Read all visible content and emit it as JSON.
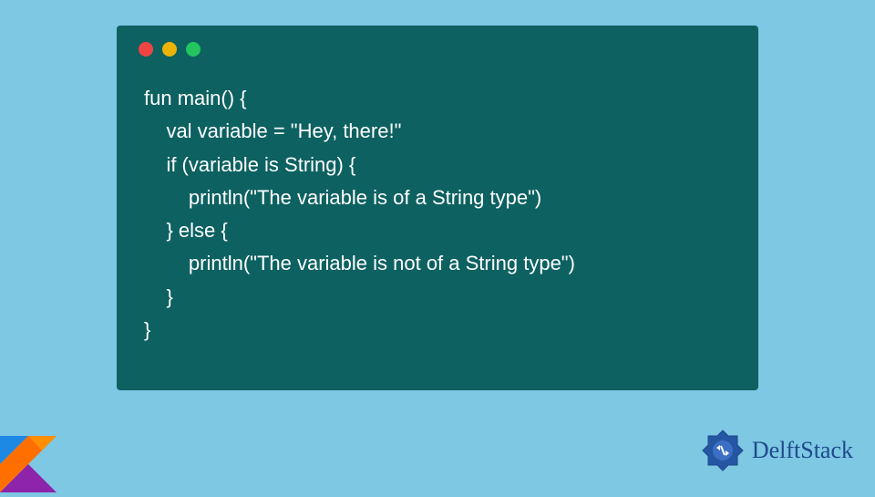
{
  "code": {
    "lines": [
      "fun main() {",
      "    val variable = \"Hey, there!\"",
      "    if (variable is String) {",
      "        println(\"The variable is of a String type\")",
      "    } else {",
      "        println(\"The variable is not of a String type\")",
      "    }",
      "}"
    ]
  },
  "branding": {
    "site_name": "DelftStack"
  },
  "colors": {
    "background": "#7ec8e3",
    "code_bg": "#0d6161",
    "code_text": "#ffffff",
    "brand_text": "#1e4a8c"
  }
}
